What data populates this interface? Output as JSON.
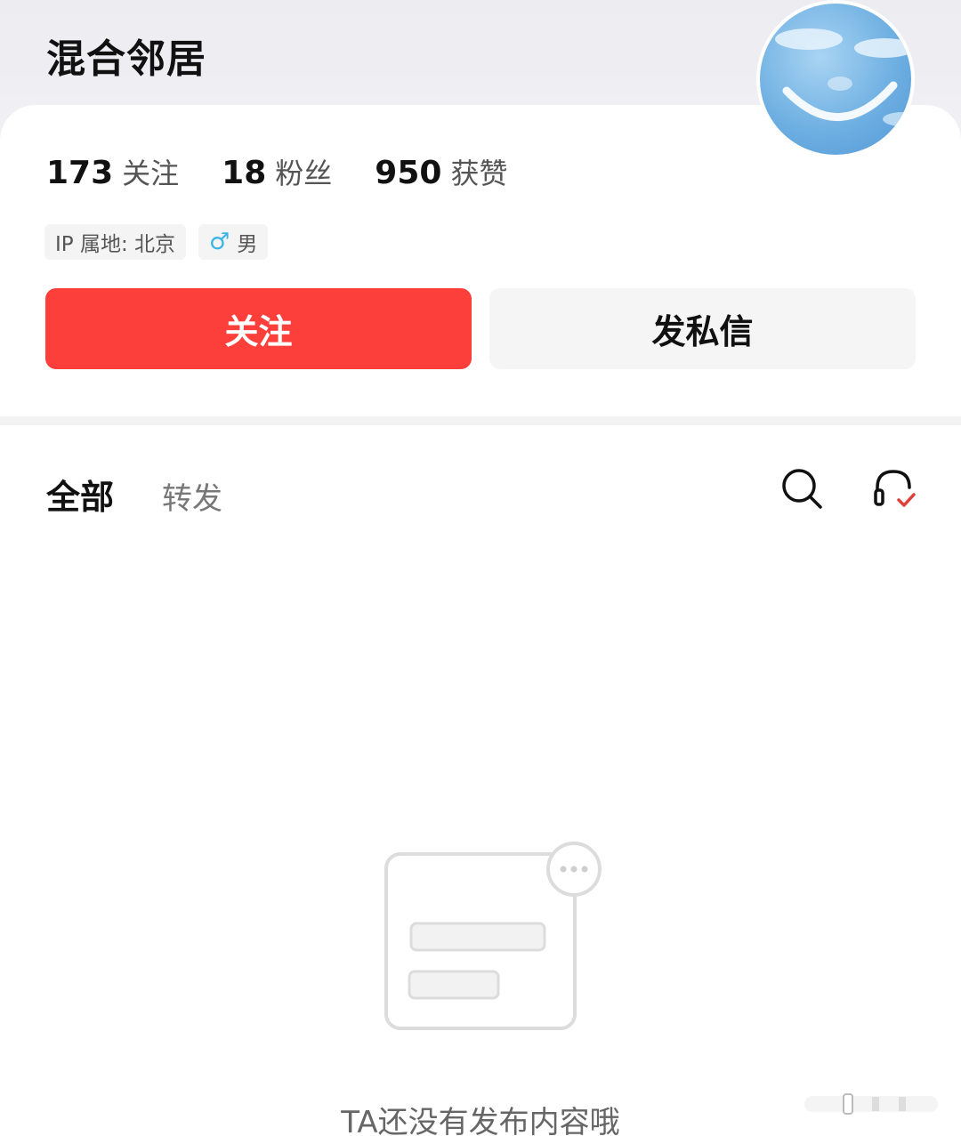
{
  "profile": {
    "username": "混合邻居",
    "avatar_icon": "sky-smiley-avatar",
    "stats": [
      {
        "value": "173",
        "label": "关注"
      },
      {
        "value": "18",
        "label": "粉丝"
      },
      {
        "value": "950",
        "label": "获赞"
      }
    ],
    "tags": {
      "ip_location": "IP 属地: 北京",
      "gender_icon": "♂",
      "gender": "男"
    }
  },
  "actions": {
    "follow_label": "关注",
    "message_label": "发私信",
    "follow_color": "#fd3f3b"
  },
  "tabs": [
    {
      "label": "全部",
      "active": true
    },
    {
      "label": "转发",
      "active": false
    }
  ],
  "toolbar": {
    "search_icon": "search-icon",
    "headset_icon": "headset-check-icon"
  },
  "empty_state": {
    "message": "TA还没有发布内容哦"
  }
}
